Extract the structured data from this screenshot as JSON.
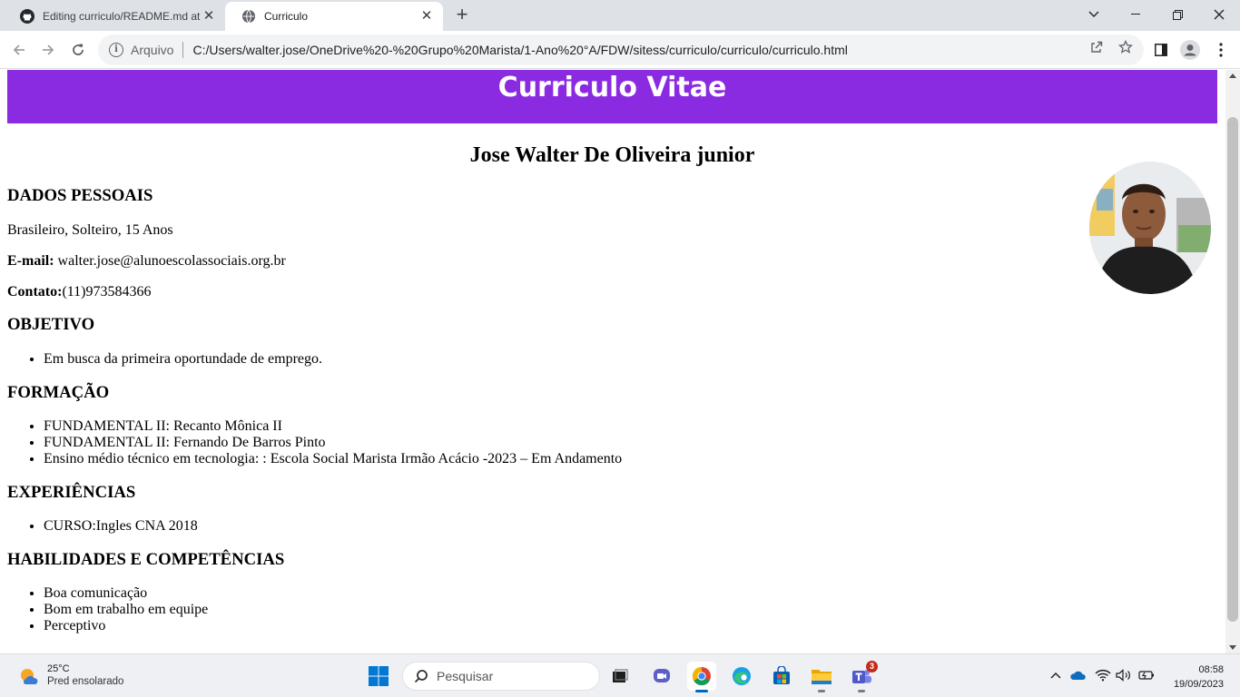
{
  "browser": {
    "tabs": [
      {
        "title": "Editing curriculo/README.md at",
        "active": false,
        "icon": "github-icon"
      },
      {
        "title": "Curriculo",
        "active": true,
        "icon": "globe-icon"
      }
    ],
    "address": {
      "scheme_label": "Arquivo",
      "url": "C:/Users/walter.jose/OneDrive%20-%20Grupo%20Marista/1-Ano%20°A/FDW/sitess/curriculo/curriculo/curriculo.html"
    }
  },
  "page": {
    "banner_title": "Curriculo Vitae",
    "name": "Jose Walter De Oliveira junior",
    "sections": {
      "personal": {
        "heading": "DADOS PESSOAIS",
        "summary": "Brasileiro, Solteiro, 15 Anos",
        "email_label": "E-mail:",
        "email_value": " walter.jose@alunoescolassociais.org.br",
        "contact_label": "Contato:",
        "contact_value": "(11)973584366"
      },
      "objective": {
        "heading": "OBJETIVO",
        "items": [
          "Em busca da primeira oportundade de emprego."
        ]
      },
      "education": {
        "heading": "FORMAÇÃO",
        "items": [
          "FUNDAMENTAL II: Recanto Mônica II",
          "FUNDAMENTAL II: Fernando De Barros Pinto",
          "Ensino médio técnico em tecnologia: : Escola Social Marista Irmão Acácio -2023 – Em Andamento"
        ]
      },
      "experience": {
        "heading": "EXPERIÊNCIAS",
        "items": [
          "CURSO:Ingles CNA 2018"
        ]
      },
      "skills": {
        "heading": "HABILIDADES E COMPETÊNCIAS",
        "items": [
          "Boa comunicação",
          "Bom em trabalho em equipe",
          "Perceptivo"
        ]
      }
    }
  },
  "taskbar": {
    "weather_temp": "25°C",
    "weather_condition": "Pred ensolarado",
    "search_placeholder": "Pesquisar",
    "teams_badge": "3",
    "time": "08:58",
    "date": "19/09/2023"
  },
  "colors": {
    "banner": "#8a2be2",
    "tab_strip": "#dee1e6",
    "taskbar": "#eef0f4"
  }
}
